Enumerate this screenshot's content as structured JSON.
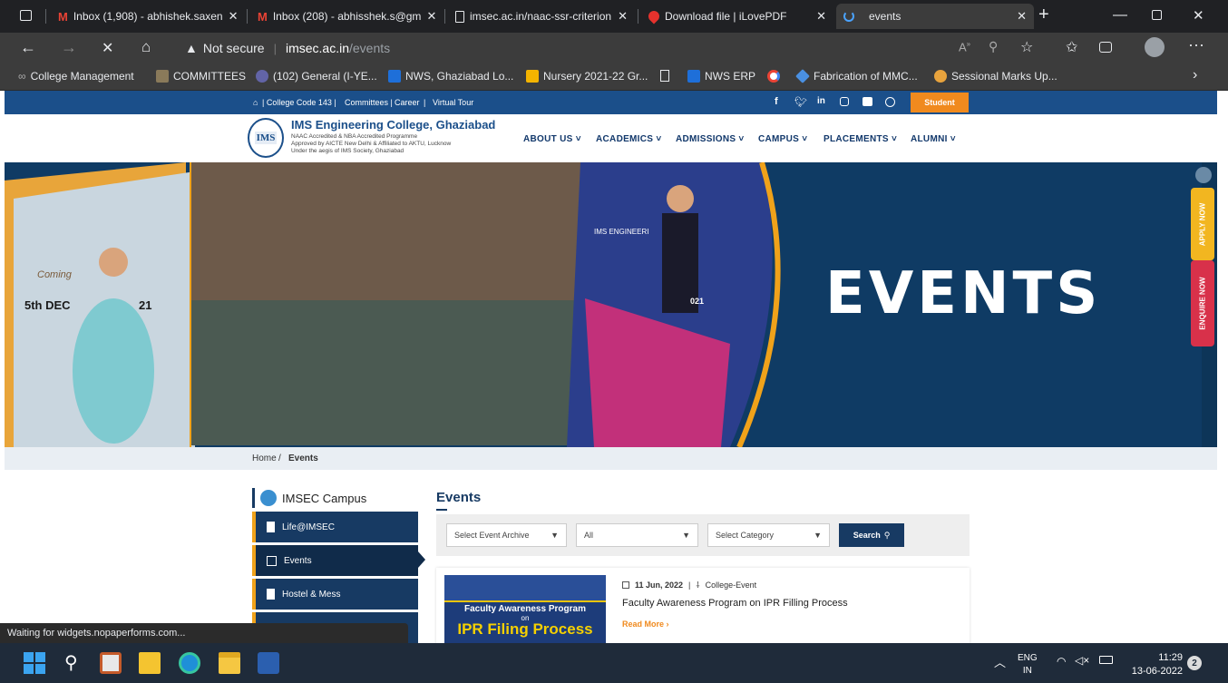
{
  "browser": {
    "tabs": [
      {
        "label": "Inbox (1,908) - abhishek.saxen",
        "icon": "gmail-icon"
      },
      {
        "label": "Inbox (208) - abhisshek.s@gm",
        "icon": "gmail-icon"
      },
      {
        "label": "imsec.ac.in/naac-ssr-criterion",
        "icon": "page-icon"
      },
      {
        "label": "Download file | iLovePDF",
        "icon": "ilovepdf-icon"
      },
      {
        "label": "events",
        "icon": "loading-icon"
      }
    ],
    "address": {
      "security": "Not secure",
      "domain": "imsec.ac.in",
      "path": "/events"
    },
    "favorites": [
      {
        "label": "College Management"
      },
      {
        "label": "COMMITTEES"
      },
      {
        "label": "(102) General (I-YE..."
      },
      {
        "label": "NWS, Ghaziabad Lo..."
      },
      {
        "label": "Nursery 2021-22 Gr..."
      },
      {
        "label": "NWS ERP"
      },
      {
        "label": "Fabrication of MMC..."
      },
      {
        "label": "Sessional Marks Up..."
      }
    ]
  },
  "site": {
    "topstrip": {
      "college_code": "| College Code 143 |",
      "committees": "Committees |",
      "career": "Career",
      "sep": "|",
      "tour": "Virtual Tour",
      "student": "Student"
    },
    "logo": {
      "abbr": "IMS",
      "name": "IMS Engineering College, Ghaziabad",
      "line1": "NAAC Accredited & NBA Accredited Programme",
      "line2": "Approved by AICTE New Delhi & Affiliated to AKTU, Lucknow",
      "line3": "Under the aegis of IMS Society, Ghaziabad"
    },
    "nav": [
      "ABOUT US",
      "ACADEMICS",
      "ADMISSIONS",
      "CAMPUS",
      "PLACEMENTS",
      "ALUMNI"
    ],
    "banner": {
      "title": "EVENTS",
      "apply": "APPLY NOW",
      "enquire": "ENQUIRE NOW",
      "photo1": {
        "t1": "Coming",
        "t2": "5th DEC",
        "t3": "21"
      },
      "photo2": {
        "t1": "IMS ENGINEERI",
        "t2": "021"
      }
    },
    "breadcrumb": {
      "home": "Home",
      "sep": "/",
      "current": "Events"
    },
    "sidebar": {
      "title": "IMSEC Campus",
      "items": [
        "Life@IMSEC",
        "Events",
        "Hostel & Mess"
      ]
    },
    "main": {
      "heading": "Events",
      "filters": {
        "archive": "Select Event Archive",
        "all": "All",
        "category": "Select Category",
        "search": "Search"
      },
      "event": {
        "date": "11 Jun, 2022",
        "sep": "|",
        "category": "College-Event",
        "title": "Faculty Awareness Program on IPR Filling Process",
        "read_more": "Read More",
        "thumb_line1": "Faculty Awareness Program",
        "thumb_line2": "on",
        "thumb_line3": "IPR Filing Process"
      }
    }
  },
  "status": "Waiting for widgets.nopaperforms.com...",
  "taskbar": {
    "lang1": "ENG",
    "lang2": "IN",
    "time": "11:29",
    "date": "13-06-2022",
    "badge": "2"
  }
}
